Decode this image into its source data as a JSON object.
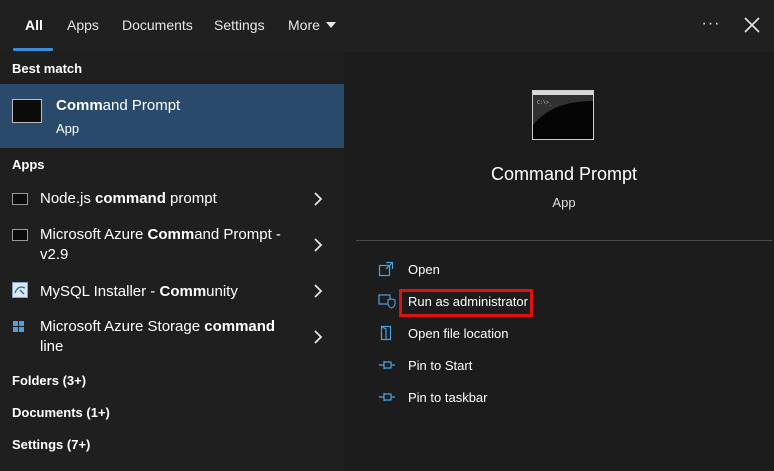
{
  "tabs": [
    {
      "label": "All"
    },
    {
      "label": "Apps"
    },
    {
      "label": "Documents"
    },
    {
      "label": "Settings"
    },
    {
      "label": "More"
    }
  ],
  "best_match": {
    "header": "Best match",
    "title_bold": "Comm",
    "title_rest": "and Prompt",
    "subtitle": "App"
  },
  "apps": {
    "header": "Apps",
    "items": [
      {
        "pre": "Node.js ",
        "bold": "command",
        "post": " prompt",
        "icon": "cmd-icon"
      },
      {
        "pre": "Microsoft Azure ",
        "bold": "Comm",
        "post": "and Prompt - v2.9",
        "icon": "cmd-icon"
      },
      {
        "pre": "MySQL Installer - ",
        "bold": "Comm",
        "post": "unity",
        "icon": "mysql-installer-icon"
      },
      {
        "pre": "Microsoft Azure Storage ",
        "bold": "command",
        "post": " line",
        "icon": "azure-storage-icon"
      }
    ]
  },
  "groups": {
    "folders": "Folders (3+)",
    "documents": "Documents (1+)",
    "settings": "Settings (7+)"
  },
  "preview": {
    "title": "Command Prompt",
    "subtitle": "App"
  },
  "actions": [
    {
      "label": "Open",
      "icon": "open-icon"
    },
    {
      "label": "Run as administrator",
      "icon": "shield-icon"
    },
    {
      "label": "Open file location",
      "icon": "file-location-icon"
    },
    {
      "label": "Pin to Start",
      "icon": "pin-icon"
    },
    {
      "label": "Pin to taskbar",
      "icon": "pin-icon"
    }
  ],
  "colors": {
    "selected_row": "#2a4a6b",
    "tab_underline": "#3b8fd6",
    "highlight_box": "#e01010",
    "icon_accent": "#4aa3e0"
  }
}
